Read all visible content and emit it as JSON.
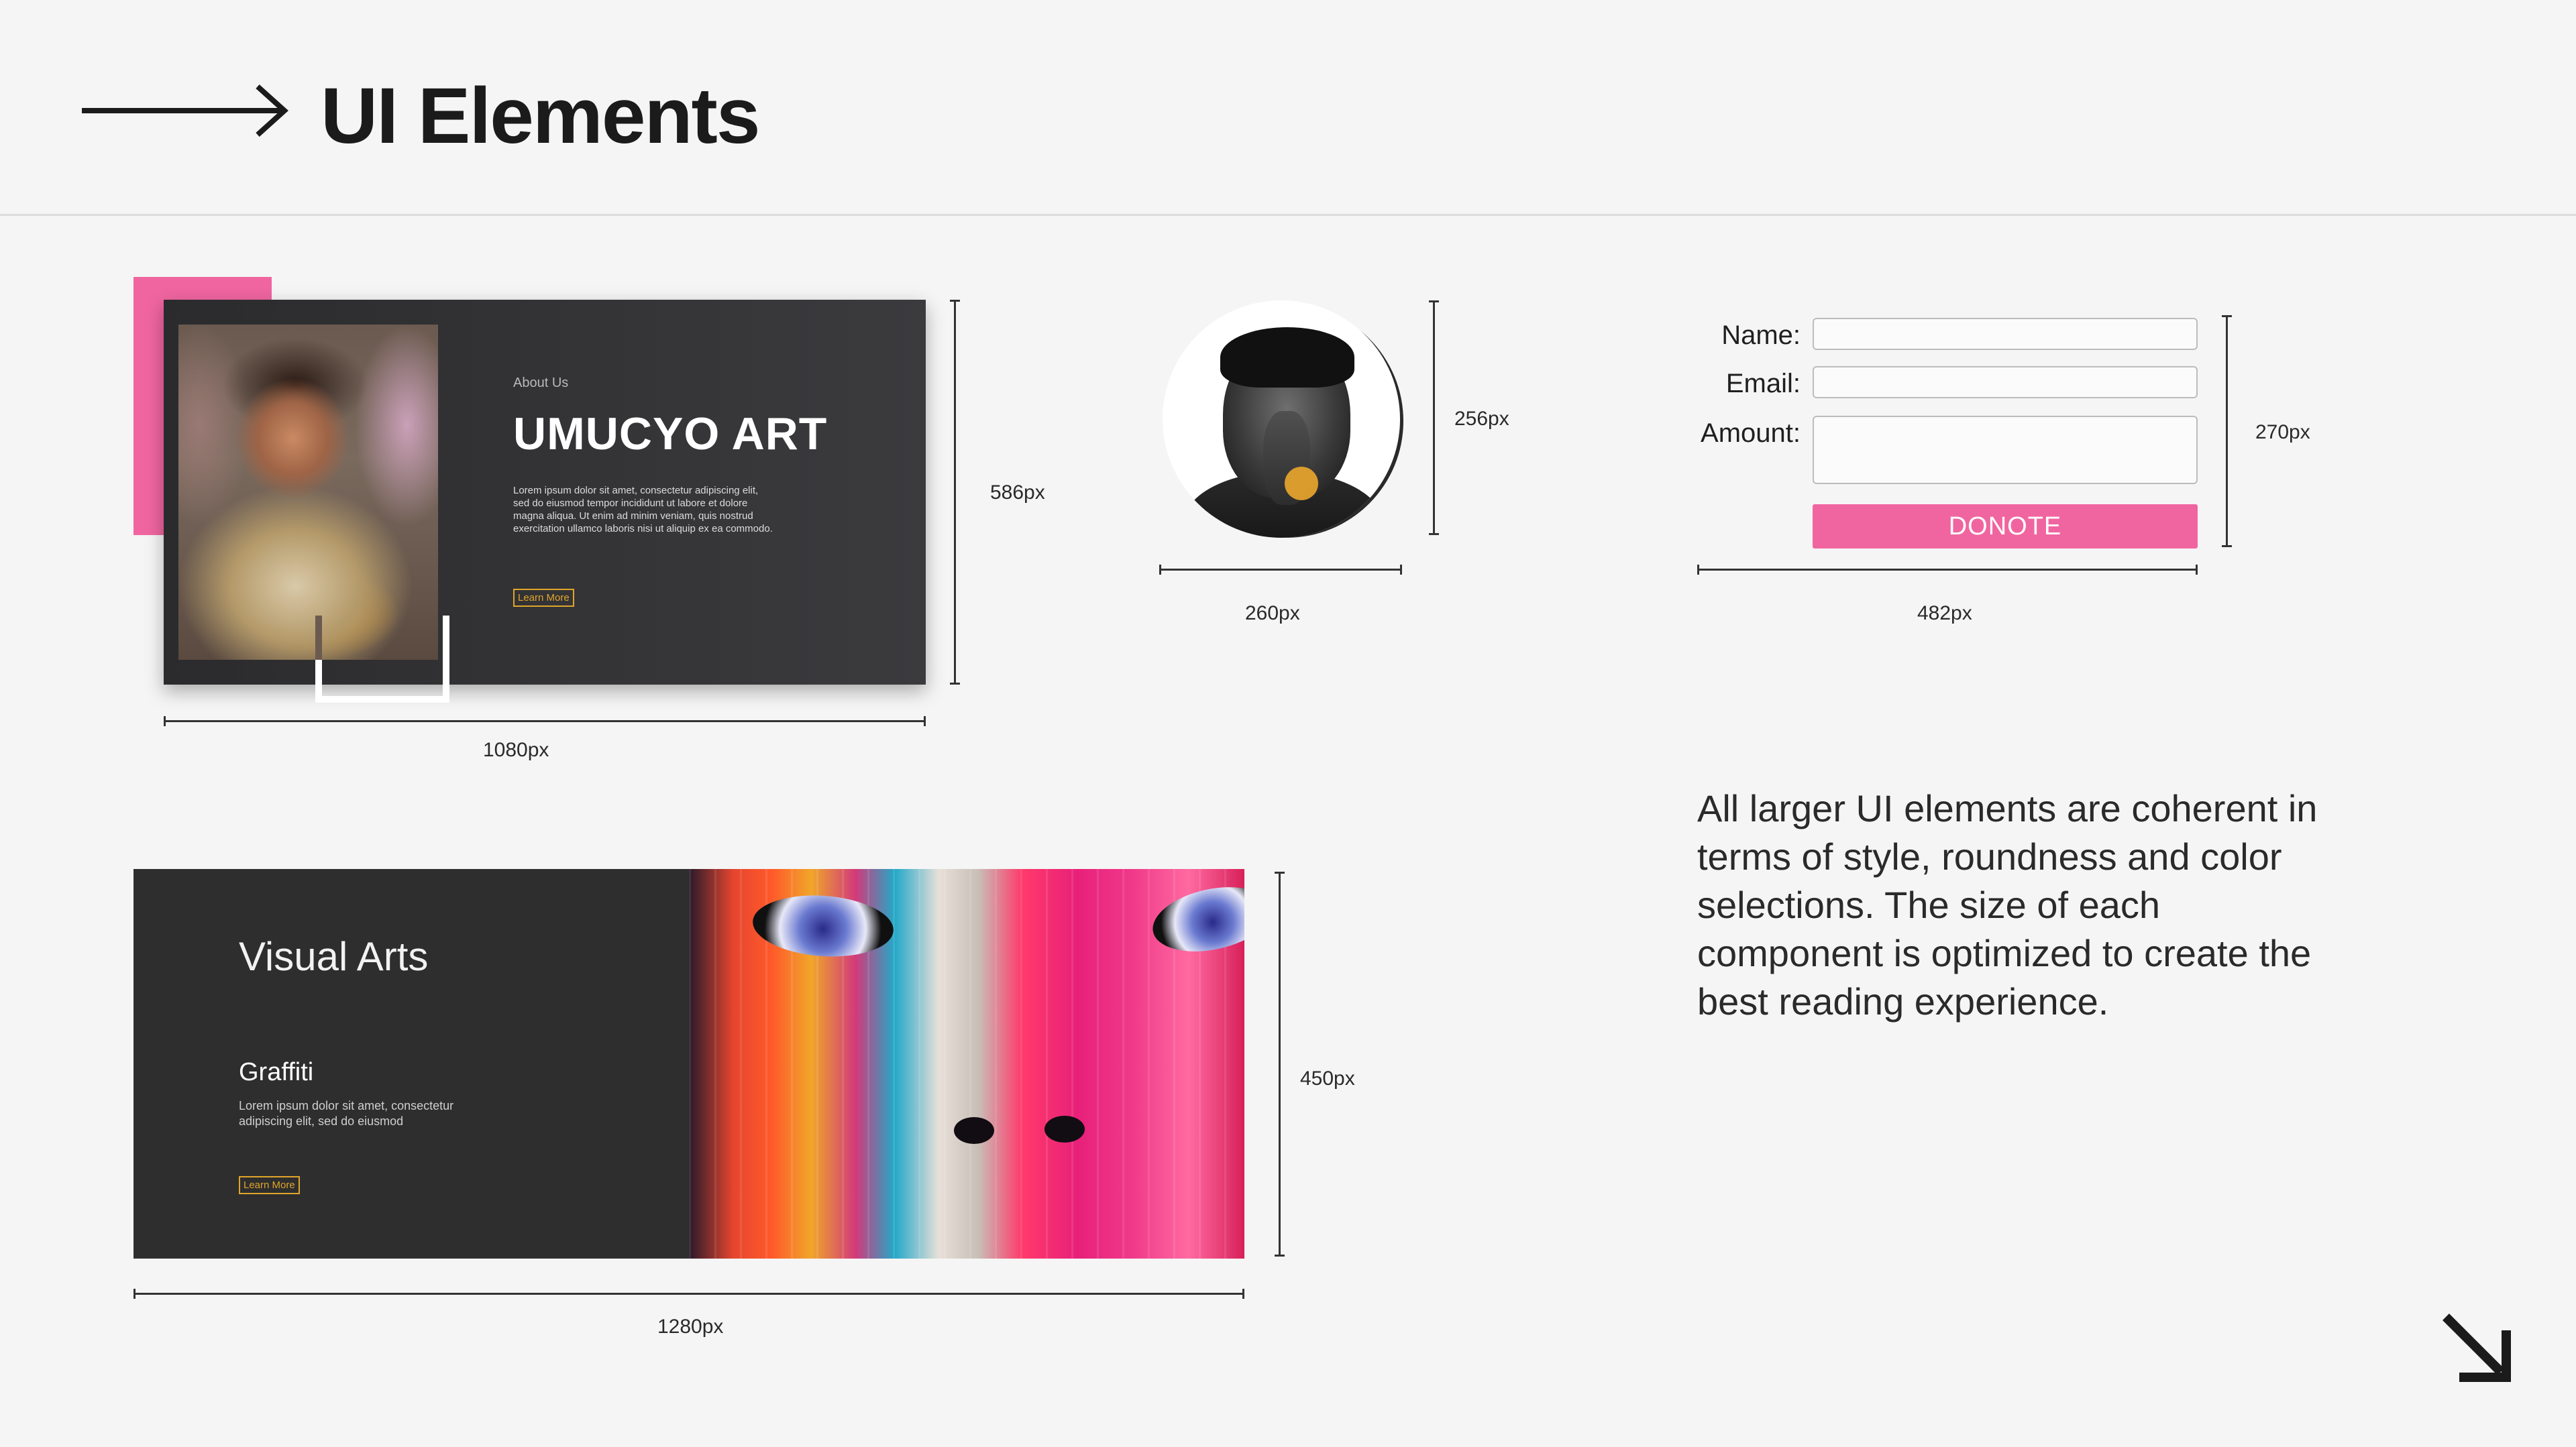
{
  "header": {
    "title": "UI Elements"
  },
  "about_card": {
    "eyebrow": "About Us",
    "heading": "UMUCYO ART",
    "body": "Lorem ipsum dolor sit amet, consectetur adipiscing elit, sed do eiusmod tempor incididunt ut labore et dolore magna aliqua. Ut enim ad minim veniam, quis nostrud exercitation ullamco laboris nisi ut aliquip ex ea commodo.",
    "button_label": "Learn More",
    "width_label": "1080px",
    "height_label": "586px"
  },
  "avatar": {
    "width_label": "260px",
    "height_label": "256px"
  },
  "donate_form": {
    "name_label": "Name:",
    "email_label": "Email:",
    "amount_label": "Amount:",
    "name_value": "",
    "email_value": "",
    "amount_value": "",
    "button_label": "DONOTE",
    "width_label": "482px",
    "height_label": "270px"
  },
  "description": "All larger UI elements are coherent in terms of style, roundness and color selections. The size of each component is optimized to create the best reading experience.",
  "arts_card": {
    "title": "Visual Arts",
    "subtitle": "Graffiti",
    "body": "Lorem ipsum dolor sit amet, consectetur adipiscing elit, sed do eiusmod",
    "button_label": "Learn More",
    "width_label": "1280px",
    "height_label": "450px"
  },
  "colors": {
    "accent_pink": "#f065a0",
    "accent_gold": "#e0a52a",
    "card_dark": "#2e2e2e",
    "background": "#f5f5f5"
  },
  "icons": {
    "header_arrow": "arrow-right-icon",
    "corner_arrow": "arrow-down-right-icon"
  }
}
